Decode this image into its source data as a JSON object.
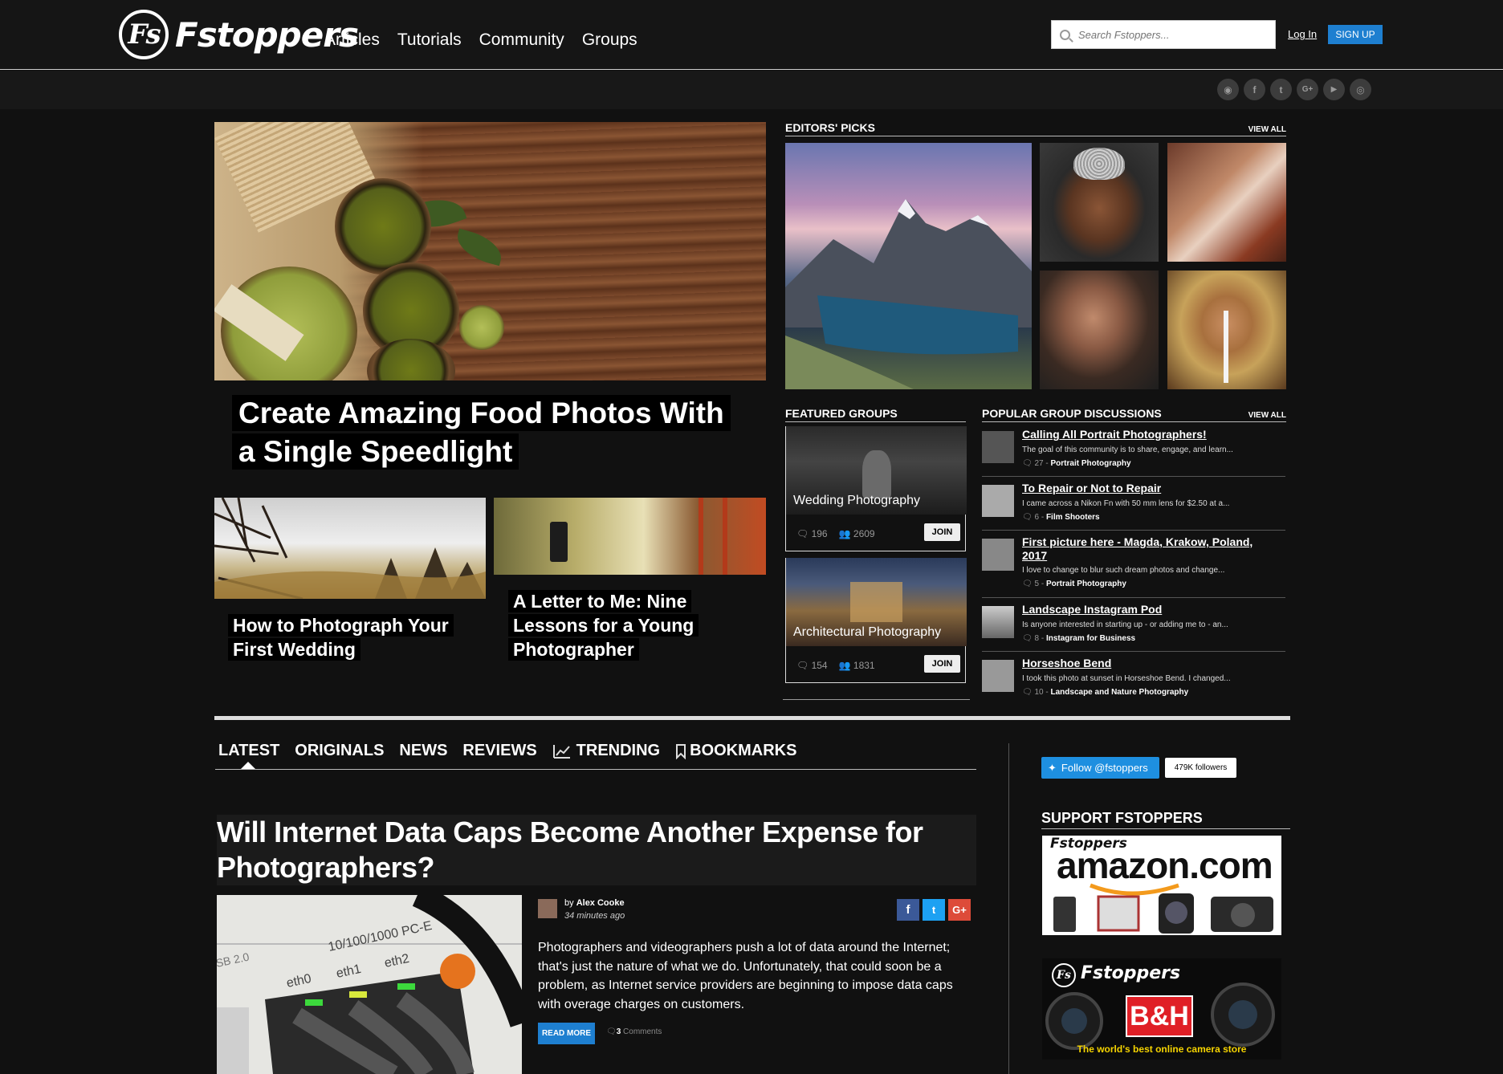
{
  "brand": {
    "logo_mark": "Fs",
    "logo_text": "Fstoppers"
  },
  "nav": [
    "Articles",
    "Tutorials",
    "Community",
    "Groups"
  ],
  "search": {
    "placeholder": "Search Fstoppers..."
  },
  "auth": {
    "login": "Log In",
    "signup": "SIGN UP"
  },
  "socials": [
    {
      "icon": "rss-icon",
      "glyph": "◉"
    },
    {
      "icon": "facebook-icon",
      "glyph": "f"
    },
    {
      "icon": "twitter-icon",
      "glyph": "t"
    },
    {
      "icon": "google-plus-icon",
      "glyph": "G+"
    },
    {
      "icon": "youtube-icon",
      "glyph": "▶"
    },
    {
      "icon": "instagram-icon",
      "glyph": "◎"
    }
  ],
  "hero": {
    "title": "Create Amazing Food Photos With a Single Speedlight"
  },
  "cards": [
    {
      "title": "How to Photograph Your First Wedding"
    },
    {
      "title": "A Letter to Me: Nine Lessons for a Young Photographer"
    }
  ],
  "editors_picks": {
    "heading": "EDITORS' PICKS",
    "view_all": "VIEW ALL"
  },
  "featured_groups": {
    "heading": "FEATURED GROUPS",
    "groups": [
      {
        "name": "Wedding Photography",
        "discussions": "196",
        "members": "2609",
        "join": "JOIN"
      },
      {
        "name": "Architectural Photography",
        "discussions": "154",
        "members": "1831",
        "join": "JOIN"
      }
    ]
  },
  "popular": {
    "heading": "POPULAR GROUP DISCUSSIONS",
    "view_all": "VIEW ALL",
    "items": [
      {
        "title": "Calling All Portrait Photographers!",
        "desc": "The goal of this community is to share, engage, and learn...",
        "count": "27",
        "group": "Portrait Photography"
      },
      {
        "title": "To Repair or Not to Repair",
        "desc": "I came across a Nikon Fn with 50 mm lens for $2.50 at a...",
        "count": "6",
        "group": "Film Shooters"
      },
      {
        "title": "First picture here - Magda, Krakow, Poland, 2017",
        "desc": "I love to change to blur such dream photos and change...",
        "count": "5",
        "group": "Portrait Photography"
      },
      {
        "title": "Landscape Instagram Pod",
        "desc": "Is anyone interested in starting up - or adding me to - an...",
        "count": "8",
        "group": "Instagram for Business"
      },
      {
        "title": "Horseshoe Bend",
        "desc": "I took this photo at sunset in Horseshoe Bend. I changed...",
        "count": "10",
        "group": "Landscape and Nature Photography"
      }
    ]
  },
  "tabs": [
    "LATEST",
    "ORIGINALS",
    "NEWS",
    "REVIEWS",
    "TRENDING",
    "BOOKMARKS"
  ],
  "article": {
    "title": "Will Internet Data Caps Become Another Expense for Photographers?",
    "by": "by",
    "author": "Alex Cooke",
    "time": "34 minutes ago",
    "excerpt": "Photographers and videographers push a lot of data around the Internet; that's just the nature of what we do. Unfortunately, that could soon be a problem, as Internet service providers are beginning to impose data caps with overage charges on customers.",
    "read_more": "READ MORE",
    "comment_count": "3",
    "comments_label": "Comments",
    "image_labels": [
      "10/100/1000 PC-E",
      "eth0",
      "eth1",
      "eth2",
      "SB 2.0"
    ]
  },
  "sidebar": {
    "follow": "Follow @fstoppers",
    "followers": "479K followers",
    "support_heading": "SUPPORT FSTOPPERS",
    "amazon_brand": "Fstoppers",
    "amazon_text": "amazon.com",
    "bh_brand": "Fstoppers",
    "bh_logo": "B&H",
    "bh_tagline": "The world's best online camera store"
  },
  "colors": {
    "background": "#111111",
    "accent_blue": "#1e7fd0",
    "google_red": "#dd4b39",
    "facebook": "#3b5998",
    "twitter": "#1da1f2"
  }
}
